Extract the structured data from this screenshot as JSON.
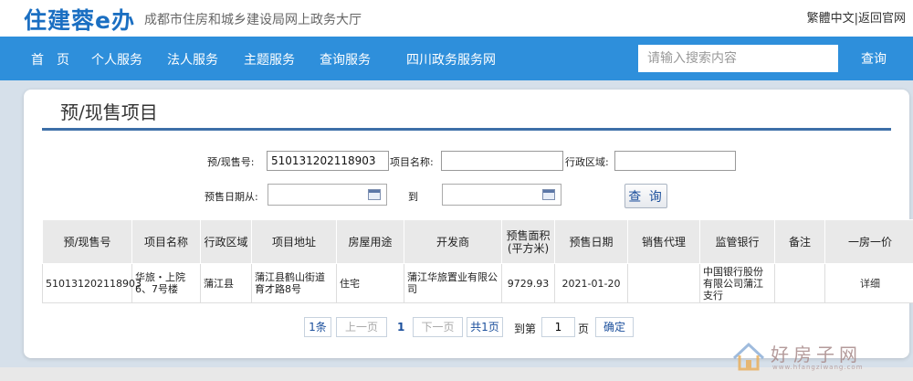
{
  "header": {
    "logo": "住建蓉e办",
    "subtitle": "成都市住房和城乡建设局网上政务大厅",
    "traditional": "繁體中文",
    "separator": "|",
    "return_home": "返回官网"
  },
  "nav": {
    "items": [
      "首　页",
      "个人服务",
      "法人服务",
      "主题服务",
      "查询服务",
      "四川政务服务网"
    ],
    "search_placeholder": "请输入搜索内容",
    "search_button": "查询"
  },
  "page": {
    "title": "预/现售项目"
  },
  "form": {
    "presale_no_label": "预/现售号:",
    "presale_no_value": "510131202118903",
    "project_name_label": "项目名称:",
    "project_name_value": "",
    "district_label": "行政区域:",
    "district_value": "",
    "date_from_label": "预售日期从:",
    "date_to_label": "到",
    "query_button": "查 询"
  },
  "table": {
    "headers": [
      "预/现售号",
      "项目名称",
      "行政区域",
      "项目地址",
      "房屋用途",
      "开发商",
      "预售面积\n(平方米)",
      "预售日期",
      "销售代理",
      "监管银行",
      "备注",
      "一房一价"
    ],
    "rows": [
      [
        "510131202118903",
        "华旅・上院6、7号楼",
        "蒲江县",
        "蒲江县鹤山街道育才路8号",
        "住宅",
        "蒲江华旅置业有限公司",
        "9729.93",
        "2021-01-20",
        "",
        "中国银行股份有限公司蒲江支行",
        "",
        "详细"
      ]
    ]
  },
  "pager": {
    "count": "1条",
    "prev": "上一页",
    "current": "1",
    "next": "下一页",
    "total": "共1页",
    "goto_prefix": "到第",
    "goto_value": "1",
    "goto_suffix": "页",
    "confirm": "确定"
  },
  "watermark": {
    "text": "好房子网",
    "url": "www.hfangziwang.com"
  },
  "colors": {
    "brand": "#2e8fdb",
    "title_line": "#3d6fa8",
    "logo": "#1b6fc2"
  }
}
